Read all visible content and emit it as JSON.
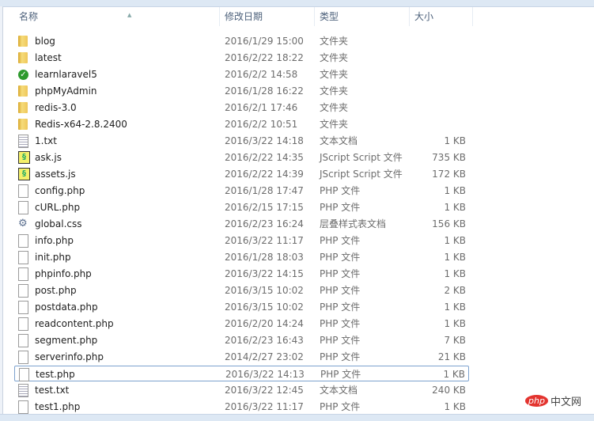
{
  "columns": {
    "name": "名称",
    "date": "修改日期",
    "type": "类型",
    "size": "大小"
  },
  "files": [
    {
      "name": "blog",
      "date": "2016/1/29 15:00",
      "type": "文件夹",
      "size": "",
      "icon": "folder"
    },
    {
      "name": "latest",
      "date": "2016/2/22 18:22",
      "type": "文件夹",
      "size": "",
      "icon": "folder"
    },
    {
      "name": "learnlaravel5",
      "date": "2016/2/2 14:58",
      "type": "文件夹",
      "size": "",
      "icon": "ok"
    },
    {
      "name": "phpMyAdmin",
      "date": "2016/1/28 16:22",
      "type": "文件夹",
      "size": "",
      "icon": "folder"
    },
    {
      "name": "redis-3.0",
      "date": "2016/2/1 17:46",
      "type": "文件夹",
      "size": "",
      "icon": "folder"
    },
    {
      "name": "Redis-x64-2.8.2400",
      "date": "2016/2/2 10:51",
      "type": "文件夹",
      "size": "",
      "icon": "folder"
    },
    {
      "name": "1.txt",
      "date": "2016/3/22 14:18",
      "type": "文本文档",
      "size": "1 KB",
      "icon": "txt"
    },
    {
      "name": "ask.js",
      "date": "2016/2/22 14:35",
      "type": "JScript Script 文件",
      "size": "735 KB",
      "icon": "js"
    },
    {
      "name": "assets.js",
      "date": "2016/2/22 14:39",
      "type": "JScript Script 文件",
      "size": "172 KB",
      "icon": "js"
    },
    {
      "name": "config.php",
      "date": "2016/1/28 17:47",
      "type": "PHP 文件",
      "size": "1 KB",
      "icon": "doc"
    },
    {
      "name": "cURL.php",
      "date": "2016/2/15 17:15",
      "type": "PHP 文件",
      "size": "1 KB",
      "icon": "doc"
    },
    {
      "name": "global.css",
      "date": "2016/2/23 16:24",
      "type": "层叠样式表文档",
      "size": "156 KB",
      "icon": "css"
    },
    {
      "name": "info.php",
      "date": "2016/3/22 11:17",
      "type": "PHP 文件",
      "size": "1 KB",
      "icon": "doc"
    },
    {
      "name": "init.php",
      "date": "2016/1/28 18:03",
      "type": "PHP 文件",
      "size": "1 KB",
      "icon": "doc"
    },
    {
      "name": "phpinfo.php",
      "date": "2016/3/22 14:15",
      "type": "PHP 文件",
      "size": "1 KB",
      "icon": "doc"
    },
    {
      "name": "post.php",
      "date": "2016/3/15 10:02",
      "type": "PHP 文件",
      "size": "2 KB",
      "icon": "doc"
    },
    {
      "name": "postdata.php",
      "date": "2016/3/15 10:02",
      "type": "PHP 文件",
      "size": "1 KB",
      "icon": "doc"
    },
    {
      "name": "readcontent.php",
      "date": "2016/2/20 14:24",
      "type": "PHP 文件",
      "size": "1 KB",
      "icon": "doc"
    },
    {
      "name": "segment.php",
      "date": "2016/2/23 16:43",
      "type": "PHP 文件",
      "size": "7 KB",
      "icon": "doc"
    },
    {
      "name": "serverinfo.php",
      "date": "2014/2/27 23:02",
      "type": "PHP 文件",
      "size": "21 KB",
      "icon": "doc"
    },
    {
      "name": "test.php",
      "date": "2016/3/22 14:13",
      "type": "PHP 文件",
      "size": "1 KB",
      "icon": "doc",
      "selected": true
    },
    {
      "name": "test.txt",
      "date": "2016/3/22 12:45",
      "type": "文本文档",
      "size": "240 KB",
      "icon": "txt"
    },
    {
      "name": "test1.php",
      "date": "2016/3/22 11:17",
      "type": "PHP 文件",
      "size": "1 KB",
      "icon": "doc"
    }
  ],
  "watermark": {
    "badge": "php",
    "text": "中文网"
  }
}
